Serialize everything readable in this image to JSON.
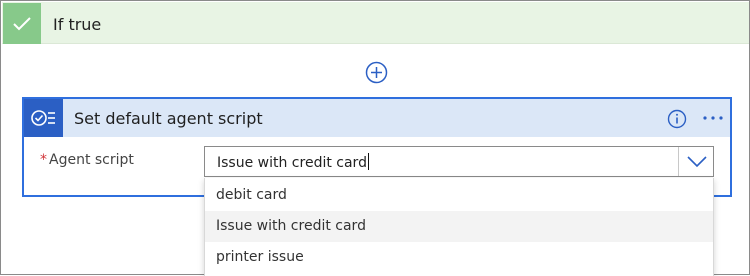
{
  "condition_branch": {
    "label": "If true",
    "accent_color": "#87c98a"
  },
  "add_step": {
    "icon": "plus-circle-icon"
  },
  "action_card": {
    "title": "Set default agent script",
    "icon": "script-checklist-icon",
    "accent_color": "#2b5fc4",
    "info_icon": "info-icon",
    "more_icon": "more-options-icon"
  },
  "field": {
    "required_marker": "*",
    "label": "Agent script",
    "value": "Issue with credit card"
  },
  "dropdown": {
    "options": [
      "debit card",
      "Issue with credit card",
      "printer issue"
    ],
    "highlighted": "Issue with credit card"
  }
}
